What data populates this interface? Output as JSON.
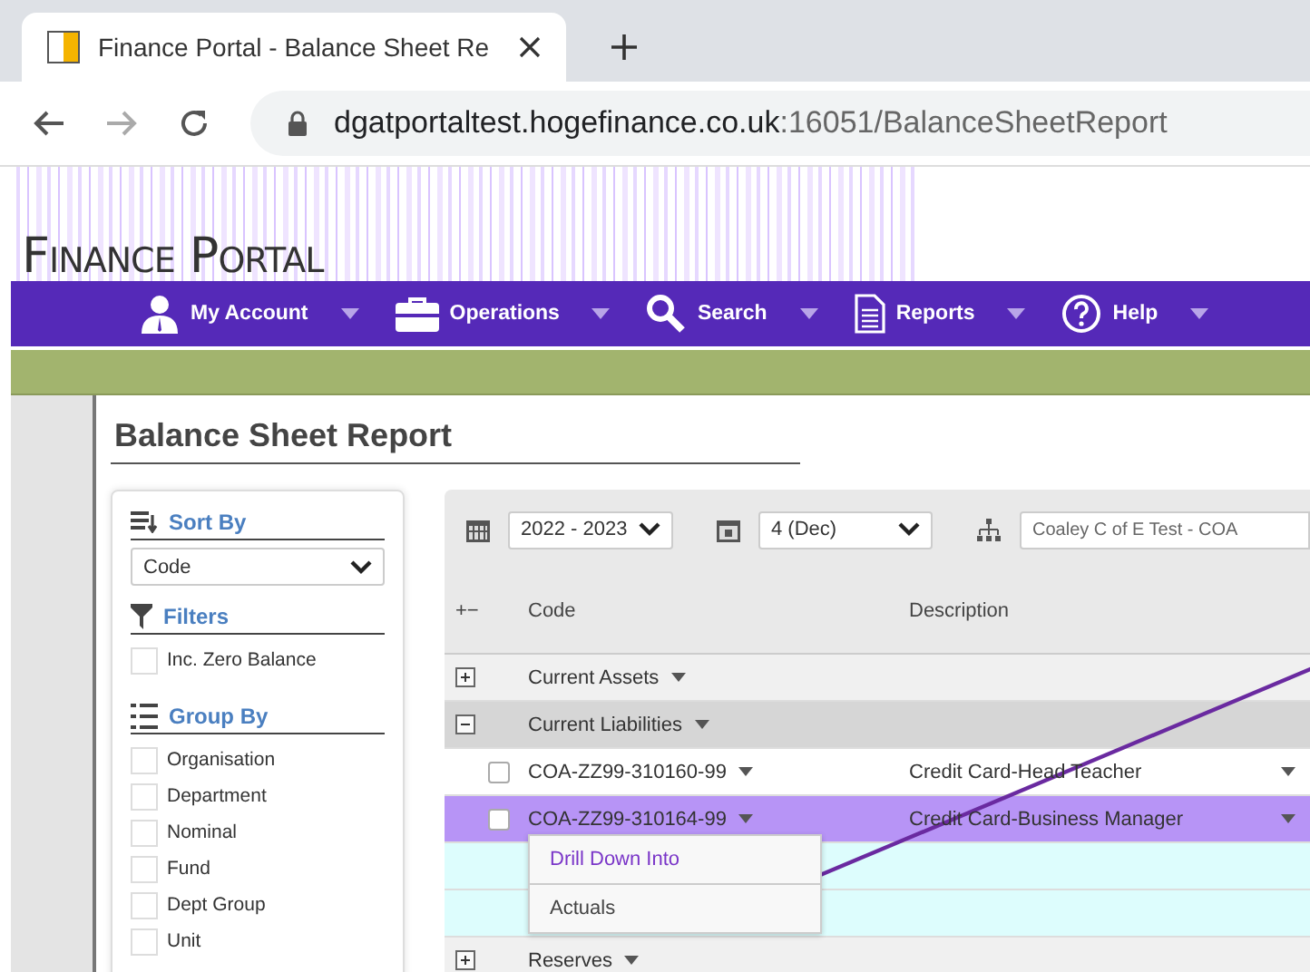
{
  "browser": {
    "tab_title": "Finance Portal - Balance Sheet Re",
    "url_host": "dgatportaltest.hogefinance.co.uk",
    "url_path": ":16051/BalanceSheetReport"
  },
  "portal": {
    "title": "Finance Portal"
  },
  "nav": [
    {
      "label": "My Account"
    },
    {
      "label": "Operations"
    },
    {
      "label": "Search"
    },
    {
      "label": "Reports"
    },
    {
      "label": "Help"
    }
  ],
  "page_title": "Balance Sheet Report",
  "sidebar": {
    "sort_by": {
      "label": "Sort By",
      "value": "Code"
    },
    "filters": {
      "label": "Filters",
      "options": [
        {
          "label": "Inc. Zero Balance",
          "checked": false
        }
      ]
    },
    "group_by": {
      "label": "Group By",
      "options": [
        {
          "label": "Organisation",
          "checked": false
        },
        {
          "label": "Department",
          "checked": false
        },
        {
          "label": "Nominal",
          "checked": false
        },
        {
          "label": "Fund",
          "checked": false
        },
        {
          "label": "Dept Group",
          "checked": false
        },
        {
          "label": "Unit",
          "checked": false
        }
      ]
    }
  },
  "toolbar": {
    "year": "2022 - 2023",
    "period": "4 (Dec)",
    "chart_of_accounts": "Coaley C of E Test - COA"
  },
  "table": {
    "expand_header": "+−",
    "columns": [
      "Code",
      "Description"
    ],
    "rows": [
      {
        "kind": "group",
        "label": "Current Assets",
        "expanded": false
      },
      {
        "kind": "group",
        "label": "Current Liabilities",
        "expanded": true
      },
      {
        "kind": "account",
        "code": "COA-ZZ99-310160-99",
        "description": "Credit Card-Head Teacher",
        "checked": false,
        "selected": false
      },
      {
        "kind": "account",
        "code": "COA-ZZ99-310164-99",
        "description": "Credit Card-Business Manager",
        "checked": false,
        "selected": true
      },
      {
        "kind": "blank"
      },
      {
        "kind": "blank"
      },
      {
        "kind": "group",
        "label": "Reserves",
        "expanded": false
      }
    ]
  },
  "context_menu": [
    {
      "label": "Drill Down Into",
      "selected": true
    },
    {
      "label": "Actuals",
      "selected": false
    }
  ]
}
